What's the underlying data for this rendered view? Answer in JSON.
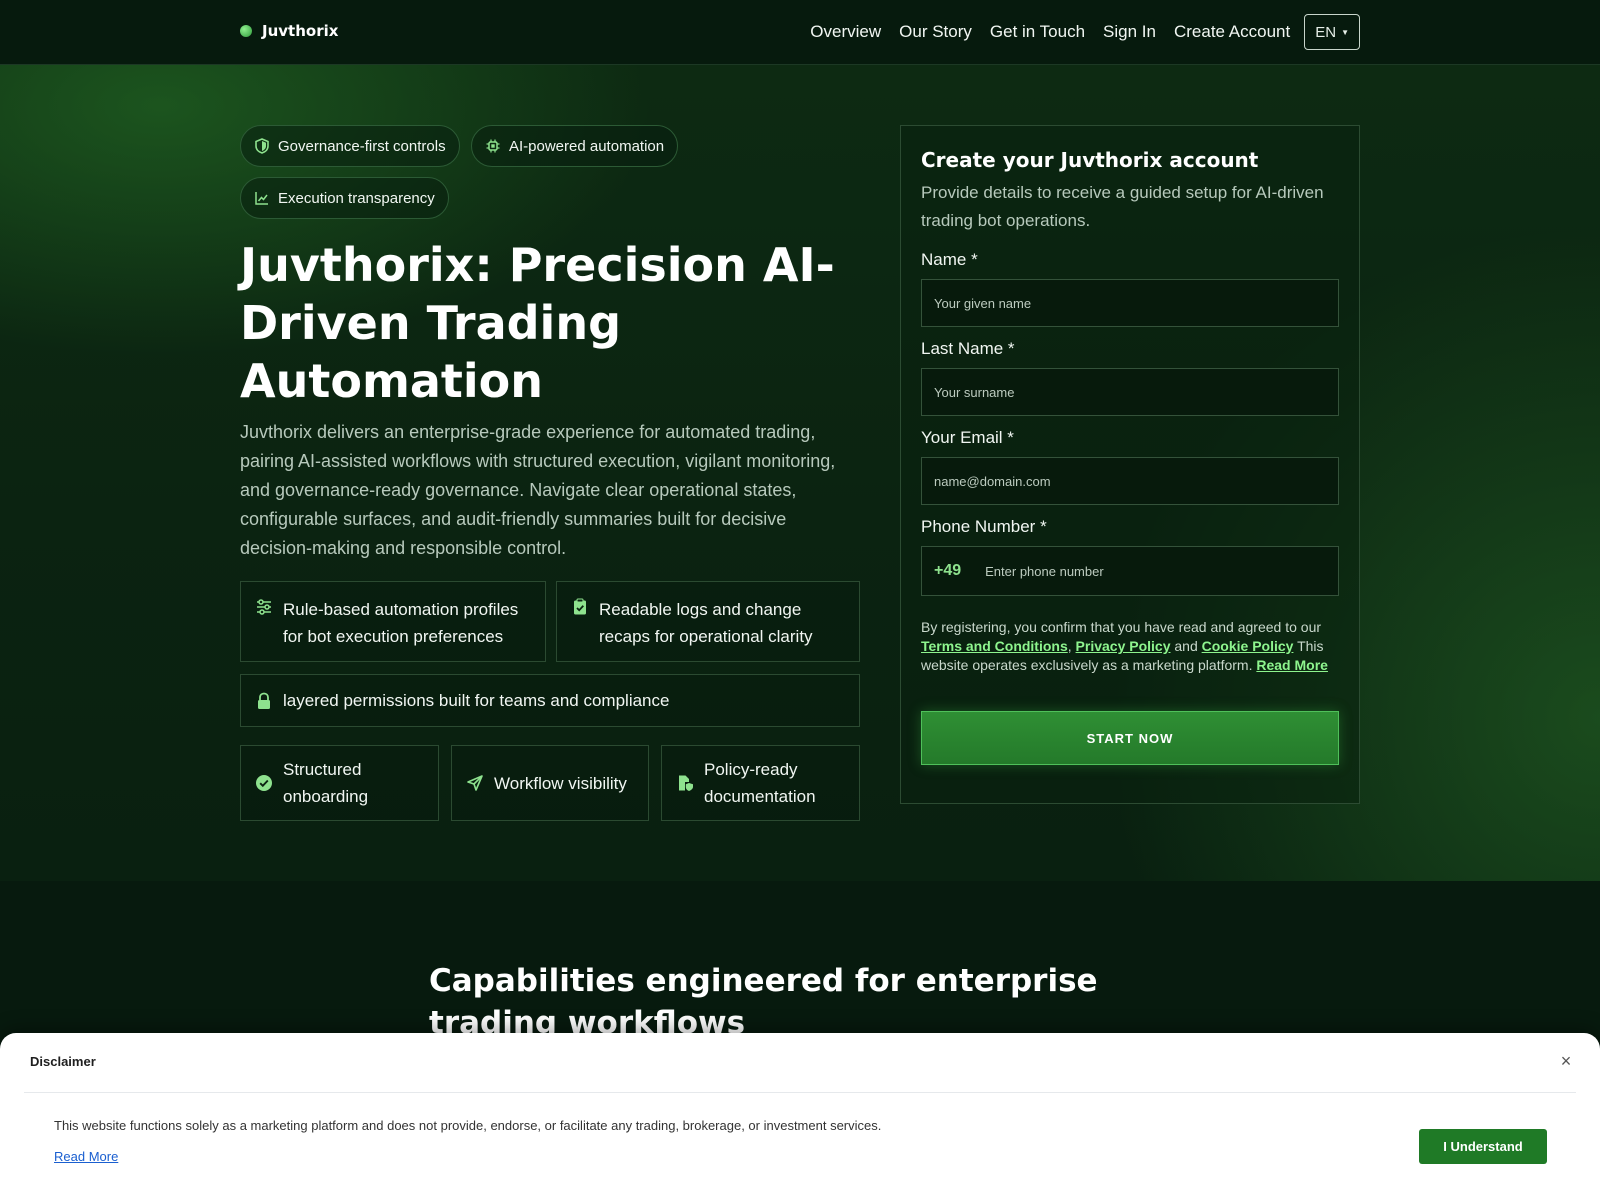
{
  "header": {
    "brand": "Juvthorix",
    "nav": [
      "Overview",
      "Our Story",
      "Get in Touch",
      "Sign In",
      "Create Account"
    ],
    "language": "EN"
  },
  "hero": {
    "pills": [
      {
        "label": "Governance-first controls",
        "icon": "shield-icon"
      },
      {
        "label": "AI-powered automation",
        "icon": "chip-icon"
      },
      {
        "label": "Execution transparency",
        "icon": "chart-line-icon"
      }
    ],
    "title": "Juvthorix: Precision AI-Driven Trading Automation",
    "description": "Juvthorix delivers an enterprise-grade experience for automated trading, pairing AI-assisted workflows with structured execution, vigilant monitoring, and governance-ready governance. Navigate clear operational states, configurable surfaces, and audit-friendly summaries built for decisive decision-making and responsible control.",
    "features": [
      {
        "label": "Rule-based automation profiles for bot execution preferences",
        "icon": "sliders-icon"
      },
      {
        "label": "Readable logs and change recaps for operational clarity",
        "icon": "clipboard-check-icon"
      },
      {
        "label": "layered permissions built for teams and compliance",
        "icon": "lock-icon"
      },
      {
        "label": "Structured onboarding",
        "icon": "check-circle-icon"
      },
      {
        "label": "Workflow visibility",
        "icon": "send-icon"
      },
      {
        "label": "Policy-ready documentation",
        "icon": "file-shield-icon"
      }
    ]
  },
  "form": {
    "title": "Create your Juvthorix account",
    "subtitle": "Provide details to receive a guided setup for AI-driven trading bot operations.",
    "name_label": "Name *",
    "name_placeholder": "Your given name",
    "last_label": "Last Name *",
    "last_placeholder": "Your surname",
    "email_label": "Your Email *",
    "email_placeholder": "name@domain.com",
    "phone_label": "Phone Number *",
    "phone_prefix": "+49",
    "phone_placeholder": "Enter phone number",
    "consent_pre": "By registering, you confirm that you have read and agreed to our ",
    "terms": "Terms and Conditions",
    "sep": ", ",
    "privacy": "Privacy Policy",
    "and": " and ",
    "cookie": "Cookie Policy",
    "consent_post": " This website operates exclusively as a marketing platform. ",
    "read_more": "Read More",
    "submit": "START NOW"
  },
  "capabilities": {
    "title": "Capabilities engineered for enterprise trading workflows"
  },
  "disclaimer": {
    "title": "Disclaimer",
    "close": "×",
    "text": "This website functions solely as a marketing platform and does not provide, endorse, or facilitate any trading, brokerage, or investment services.",
    "read_more": "Read More",
    "button": "I Understand"
  },
  "colors": {
    "accent": "#8ee28e",
    "cta": "#2f8f34",
    "background": "#071a0e"
  }
}
